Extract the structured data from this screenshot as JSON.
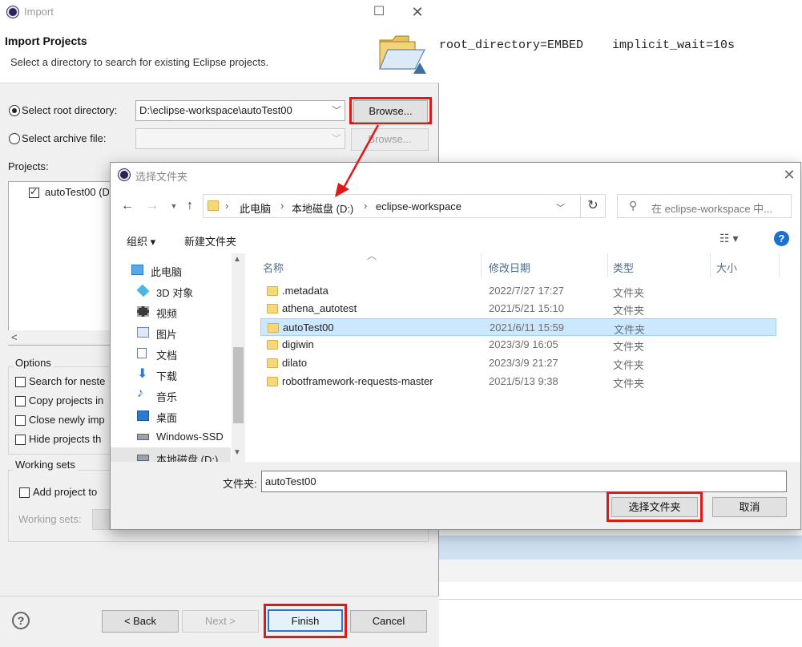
{
  "background_editor": {
    "code_line": "root_directory=EMBED    implicit_wait=10s"
  },
  "import_dialog": {
    "title": "Import",
    "heading": "Import Projects",
    "description": "Select a directory to search for existing Eclipse projects.",
    "select_root_label": "Select root directory:",
    "root_directory_value": "D:\\eclipse-workspace\\autoTest00",
    "browse_label": "Browse...",
    "select_archive_label": "Select archive file:",
    "archive_value": "",
    "archive_browse_label": "Browse...",
    "projects_label": "Projects:",
    "projects": [
      "autoTest00 (D"
    ],
    "options_label": "Options",
    "options": [
      "Search for neste",
      "Copy projects in",
      "Close newly imp",
      "Hide projects th"
    ],
    "working_sets_group_label": "Working sets",
    "add_project_label": "Add project to",
    "working_sets_label": "Working sets:",
    "help_icon": "?",
    "back_label": "< Back",
    "next_label": "Next >",
    "finish_label": "Finish",
    "cancel_label": "Cancel"
  },
  "folder_chooser": {
    "title": "选择文件夹",
    "breadcrumb": [
      "此电脑",
      "本地磁盘 (D:)",
      "eclipse-workspace"
    ],
    "search_placeholder": "在 eclipse-workspace 中...",
    "organize_label": "组织 ▾",
    "new_folder_label": "新建文件夹",
    "columns": [
      "名称",
      "修改日期",
      "类型",
      "大小"
    ],
    "nav_items": [
      "此电脑",
      "3D 对象",
      "视频",
      "图片",
      "文档",
      "下载",
      "音乐",
      "桌面",
      "Windows-SSD",
      "本地磁盘 (D:)"
    ],
    "files": [
      {
        "name": ".metadata",
        "date": "2022/7/27 17:27",
        "type": "文件夹"
      },
      {
        "name": "athena_autotest",
        "date": "2021/5/21 15:10",
        "type": "文件夹"
      },
      {
        "name": "autoTest00",
        "date": "2021/6/11 15:59",
        "type": "文件夹"
      },
      {
        "name": "digiwin",
        "date": "2023/3/9 16:05",
        "type": "文件夹"
      },
      {
        "name": "dilato",
        "date": "2023/3/9 21:27",
        "type": "文件夹"
      },
      {
        "name": "robotframework-requests-master",
        "date": "2021/5/13 9:38",
        "type": "文件夹"
      }
    ],
    "folder_label": "文件夹:",
    "folder_value": "autoTest00",
    "select_folder_label": "选择文件夹",
    "cancel_label": "取消",
    "help_icon": "?"
  }
}
